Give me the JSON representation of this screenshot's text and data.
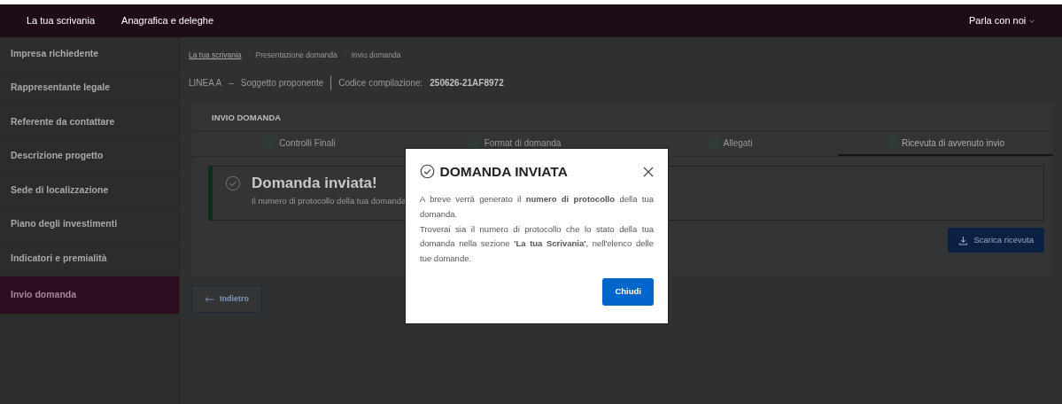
{
  "navbar": {
    "links": [
      {
        "label": "La tua scrivania"
      },
      {
        "label": "Anagrafica e deleghe"
      }
    ],
    "contact": "Parla con noi"
  },
  "sidebar": {
    "items": [
      {
        "label": "Impresa richiedente",
        "selected": false
      },
      {
        "label": "Rappresentante legale",
        "selected": false
      },
      {
        "label": "Referente da contattare",
        "selected": false
      },
      {
        "label": "Descrizione progetto",
        "selected": false
      },
      {
        "label": "Sede di localizzazione",
        "selected": false
      },
      {
        "label": "Piano degli investimenti",
        "selected": false
      },
      {
        "label": "Indicatori e premialità",
        "selected": false
      },
      {
        "label": "Invio domanda",
        "selected": true
      }
    ]
  },
  "breadcrumb": [
    {
      "label": "La tua scrivania",
      "link": true
    },
    {
      "label": "Presentazione domanda",
      "link": false
    },
    {
      "label": "Invio domanda",
      "link": false
    }
  ],
  "header": {
    "line": "LINEA A",
    "dash": "–",
    "subject": "Soggetto proponente",
    "code_label": "Codice compilazione:",
    "code": "250626-21AF8972"
  },
  "card": {
    "title": "INVIO DOMANDA",
    "tabs": [
      {
        "label": "Controlli Finali",
        "selected": false
      },
      {
        "label": "Format di domanda",
        "selected": false
      },
      {
        "label": "Allegati",
        "selected": false
      },
      {
        "label": "Ricevuta di avvenuto invio",
        "selected": true
      }
    ],
    "alert": {
      "title": "Domanda inviata!",
      "text": "Il numero di protocollo della tua domanda"
    },
    "download_button": "Scarica ricevuta"
  },
  "back_button": "Indietro",
  "modal": {
    "title": "DOMANDA INVIATA",
    "paragraphs": [
      "A breve verrà generato il **numero di protocollo** della tua domanda.",
      "Troverai sia il numero di protocollo che lo stato della tua domanda nella sezione **'La tua Scrivania'**, nell'elenco delle tue domande."
    ],
    "button": "Chiudi"
  }
}
